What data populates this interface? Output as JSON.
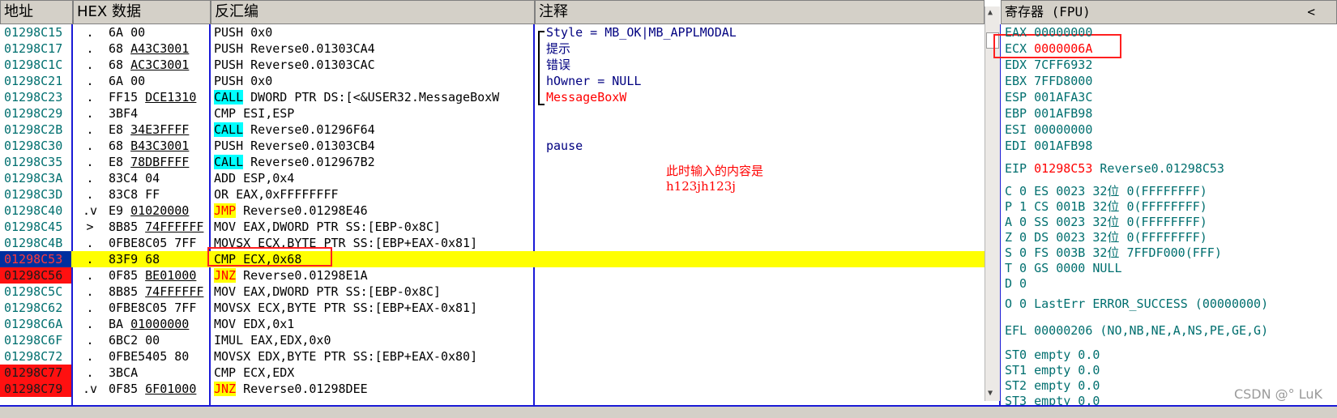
{
  "headers": {
    "addr": "地址",
    "hex": "HEX 数据",
    "disasm": "反汇编",
    "comment": "注释",
    "regs": "寄存器 (FPU)",
    "collapse": "<"
  },
  "rows": [
    {
      "addr": "01298C15",
      "mark": ".",
      "hex": "6A 00",
      "dis": "PUSH 0x0",
      "cmt": "Style = MB_OK|MB_APPLMODAL"
    },
    {
      "addr": "01298C17",
      "mark": ".",
      "hex": "68 A43C3001",
      "dis": "PUSH Reverse0.01303CA4",
      "cmt": "提示"
    },
    {
      "addr": "01298C1C",
      "mark": ".",
      "hex": "68 AC3C3001",
      "dis": "PUSH Reverse0.01303CAC",
      "cmt": "错误"
    },
    {
      "addr": "01298C21",
      "mark": ".",
      "hex": "6A 00",
      "dis": "PUSH 0x0",
      "cmt": "hOwner = NULL"
    },
    {
      "addr": "01298C23",
      "mark": ".",
      "hex": "FF15 DCE1310",
      "dis": "CALL DWORD PTR DS:[<&USER32.MessageBoxW",
      "cmt": "MessageBoxW"
    },
    {
      "addr": "01298C29",
      "mark": ".",
      "hex": "3BF4",
      "dis": "CMP ESI,ESP",
      "cmt": ""
    },
    {
      "addr": "01298C2B",
      "mark": ".",
      "hex": "E8 34E3FFFF",
      "dis": "CALL Reverse0.01296F64",
      "cmt": ""
    },
    {
      "addr": "01298C30",
      "mark": ".",
      "hex": "68 B43C3001",
      "dis": "PUSH Reverse0.01303CB4",
      "cmt": "pause"
    },
    {
      "addr": "01298C35",
      "mark": ".",
      "hex": "E8 78DBFFFF",
      "dis": "CALL Reverse0.012967B2",
      "cmt": ""
    },
    {
      "addr": "01298C3A",
      "mark": ".",
      "hex": "83C4 04",
      "dis": "ADD ESP,0x4",
      "cmt": ""
    },
    {
      "addr": "01298C3D",
      "mark": ".",
      "hex": "83C8 FF",
      "dis": "OR EAX,0xFFFFFFFF",
      "cmt": ""
    },
    {
      "addr": "01298C40",
      "mark": ".v",
      "hex": "E9 01020000",
      "dis": "JMP Reverse0.01298E46",
      "cmt": ""
    },
    {
      "addr": "01298C45",
      "mark": ">",
      "hex": "8B85 74FFFFFF",
      "dis": "MOV EAX,DWORD PTR SS:[EBP-0x8C]",
      "cmt": ""
    },
    {
      "addr": "01298C4B",
      "mark": ".",
      "hex": "0FBE8C05 7FF",
      "dis": "MOVSX ECX,BYTE PTR SS:[EBP+EAX-0x81]",
      "cmt": ""
    },
    {
      "addr": "01298C53",
      "mark": ".",
      "hex": "83F9 68",
      "dis": "CMP ECX,0x68",
      "cmt": ""
    },
    {
      "addr": "01298C56",
      "mark": ".",
      "hex": "0F85 BE01000",
      "dis": "JNZ Reverse0.01298E1A",
      "cmt": ""
    },
    {
      "addr": "01298C5C",
      "mark": ".",
      "hex": "8B85 74FFFFFF",
      "dis": "MOV EAX,DWORD PTR SS:[EBP-0x8C]",
      "cmt": ""
    },
    {
      "addr": "01298C62",
      "mark": ".",
      "hex": "0FBE8C05 7FF",
      "dis": "MOVSX ECX,BYTE PTR SS:[EBP+EAX-0x81]",
      "cmt": ""
    },
    {
      "addr": "01298C6A",
      "mark": ".",
      "hex": "BA 01000000",
      "dis": "MOV EDX,0x1",
      "cmt": ""
    },
    {
      "addr": "01298C6F",
      "mark": ".",
      "hex": "6BC2 00",
      "dis": "IMUL EAX,EDX,0x0",
      "cmt": ""
    },
    {
      "addr": "01298C72",
      "mark": ".",
      "hex": "0FBE5405 80",
      "dis": "MOVSX EDX,BYTE PTR SS:[EBP+EAX-0x80]",
      "cmt": ""
    },
    {
      "addr": "01298C77",
      "mark": ".",
      "hex": "3BCA",
      "dis": "CMP ECX,EDX",
      "cmt": ""
    },
    {
      "addr": "01298C79",
      "mark": ".v",
      "hex": "0F85 6F01000",
      "dis": "JNZ Reverse0.01298DEE",
      "cmt": ""
    }
  ],
  "registers": {
    "eax": "EAX 00000000",
    "ecx_name": "ECX",
    "ecx_val": "0000006A",
    "edx": "EDX 7CFF6932",
    "ebx": "EBX 7FFD8000",
    "esp": "ESP 001AFA3C",
    "ebp": "EBP 001AFB98",
    "esi": "ESI 00000000",
    "edi": "EDI 001AFB98",
    "eip_name": "EIP",
    "eip_val": "01298C53",
    "eip_sym": "Reverse0.01298C53",
    "flags": [
      "C 0  ES 0023 32位 0(FFFFFFFF)",
      "P 1  CS 001B 32位 0(FFFFFFFF)",
      "A 0  SS 0023 32位 0(FFFFFFFF)",
      "Z 0  DS 0023 32位 0(FFFFFFFF)",
      "S 0  FS 003B 32位 7FFDF000(FFF)",
      "T 0  GS 0000 NULL",
      "D 0",
      "O 0  LastErr ERROR_SUCCESS (00000000)"
    ],
    "efl": "EFL 00000206 (NO,NB,NE,A,NS,PE,GE,G)",
    "st": [
      "ST0 empty 0.0",
      "ST1 empty 0.0",
      "ST2 empty 0.0",
      "ST3 empty 0.0"
    ]
  },
  "annotation": {
    "line1": "此时输入的内容是",
    "line2": "h123jh123j"
  },
  "watermark": "CSDN @° LuK"
}
